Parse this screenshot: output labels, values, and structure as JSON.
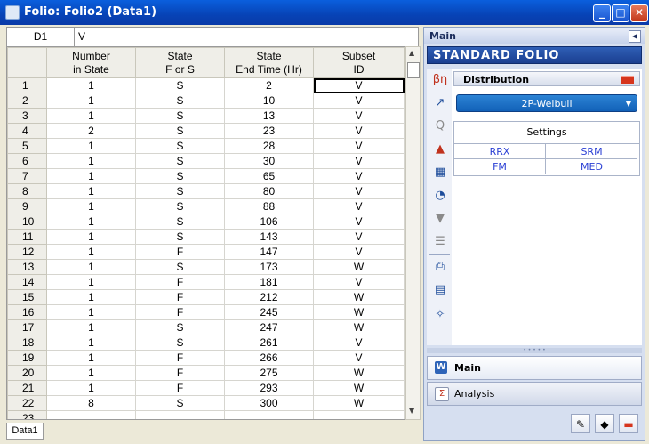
{
  "window": {
    "title": "Folio: Folio2 (Data1)",
    "min": "_",
    "max": "□",
    "close": "✕"
  },
  "formula_bar": {
    "cell_ref": "D1",
    "value": "V"
  },
  "sheet": {
    "headers": [
      {
        "line1": "Number",
        "line2": "in State"
      },
      {
        "line1": "State",
        "line2": "F or S"
      },
      {
        "line1": "State",
        "line2": "End Time (Hr)"
      },
      {
        "line1": "Subset",
        "line2": "ID"
      }
    ],
    "rows": [
      {
        "n": "1",
        "cells": [
          "1",
          "S",
          "2",
          "V"
        ]
      },
      {
        "n": "2",
        "cells": [
          "1",
          "S",
          "10",
          "V"
        ]
      },
      {
        "n": "3",
        "cells": [
          "1",
          "S",
          "13",
          "V"
        ]
      },
      {
        "n": "4",
        "cells": [
          "2",
          "S",
          "23",
          "V"
        ]
      },
      {
        "n": "5",
        "cells": [
          "1",
          "S",
          "28",
          "V"
        ]
      },
      {
        "n": "6",
        "cells": [
          "1",
          "S",
          "30",
          "V"
        ]
      },
      {
        "n": "7",
        "cells": [
          "1",
          "S",
          "65",
          "V"
        ]
      },
      {
        "n": "8",
        "cells": [
          "1",
          "S",
          "80",
          "V"
        ]
      },
      {
        "n": "9",
        "cells": [
          "1",
          "S",
          "88",
          "V"
        ]
      },
      {
        "n": "10",
        "cells": [
          "1",
          "S",
          "106",
          "V"
        ]
      },
      {
        "n": "11",
        "cells": [
          "1",
          "S",
          "143",
          "V"
        ]
      },
      {
        "n": "12",
        "cells": [
          "1",
          "F",
          "147",
          "V"
        ]
      },
      {
        "n": "13",
        "cells": [
          "1",
          "S",
          "173",
          "W"
        ]
      },
      {
        "n": "14",
        "cells": [
          "1",
          "F",
          "181",
          "V"
        ]
      },
      {
        "n": "15",
        "cells": [
          "1",
          "F",
          "212",
          "W"
        ]
      },
      {
        "n": "16",
        "cells": [
          "1",
          "F",
          "245",
          "W"
        ]
      },
      {
        "n": "17",
        "cells": [
          "1",
          "S",
          "247",
          "W"
        ]
      },
      {
        "n": "18",
        "cells": [
          "1",
          "S",
          "261",
          "V"
        ]
      },
      {
        "n": "19",
        "cells": [
          "1",
          "F",
          "266",
          "V"
        ]
      },
      {
        "n": "20",
        "cells": [
          "1",
          "F",
          "275",
          "W"
        ]
      },
      {
        "n": "21",
        "cells": [
          "1",
          "F",
          "293",
          "W"
        ]
      },
      {
        "n": "22",
        "cells": [
          "8",
          "S",
          "300",
          "W"
        ]
      },
      {
        "n": "23",
        "cells": [
          "",
          "",
          "",
          ""
        ]
      }
    ]
  },
  "sheet_tab": "Data1",
  "panel": {
    "header": "Main",
    "banner": "STANDARD FOLIO",
    "distribution_label": "Distribution",
    "distribution_value": "2P-Weibull",
    "settings_label": "Settings",
    "settings": [
      "RRX",
      "SRM",
      "FM",
      "MED"
    ],
    "nav": [
      {
        "label": "Main",
        "selected": true
      },
      {
        "label": "Analysis",
        "selected": false
      }
    ]
  },
  "icons": {
    "tool_strip": [
      "beta-icon",
      "line-icon",
      "qcp-icon",
      "mountain-icon",
      "grid-icon",
      "gauge-icon",
      "filter-icon",
      "list-icon",
      "printer-icon",
      "table-icon",
      "help-icon"
    ]
  },
  "colors": {
    "accent": "#1261b8",
    "title_bar": "#0743b6",
    "red": "#d6351d"
  }
}
